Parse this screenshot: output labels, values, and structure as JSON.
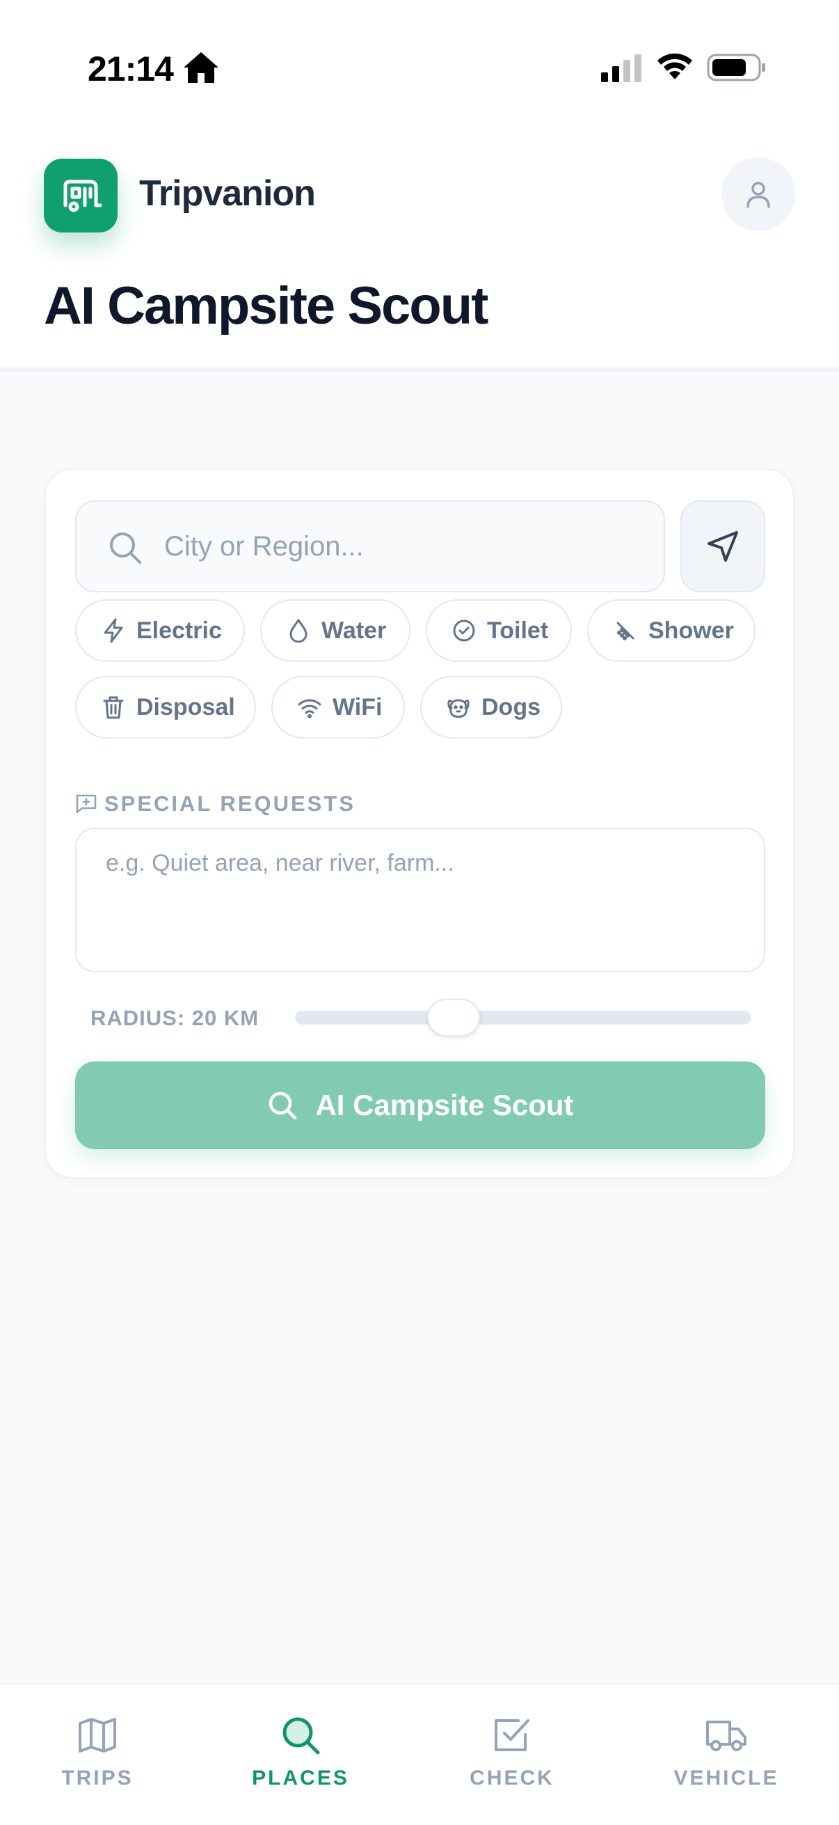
{
  "status_bar": {
    "time": "21:14",
    "icons": [
      "home-icon",
      "cellular-signal-icon",
      "wifi-icon",
      "battery-icon"
    ]
  },
  "header": {
    "app_name": "Tripvanion",
    "logo_icon": "caravan-icon",
    "profile_icon": "user-icon",
    "title": "AI Campsite Scout"
  },
  "search": {
    "placeholder": "City or Region...",
    "value": "",
    "icon": "search-icon",
    "locate_icon": "navigation-arrow-icon"
  },
  "amenities": [
    {
      "label": "Electric",
      "icon": "lightning-icon",
      "selected": false
    },
    {
      "label": "Water",
      "icon": "droplet-icon",
      "selected": false
    },
    {
      "label": "Toilet",
      "icon": "check-circle-icon",
      "selected": false
    },
    {
      "label": "Shower",
      "icon": "shower-icon",
      "selected": false
    },
    {
      "label": "Disposal",
      "icon": "trash-icon",
      "selected": false
    },
    {
      "label": "WiFi",
      "icon": "wifi-icon",
      "selected": false
    },
    {
      "label": "Dogs",
      "icon": "dog-icon",
      "selected": false
    }
  ],
  "special_requests": {
    "label": "SPECIAL REQUESTS",
    "icon": "message-plus-icon",
    "placeholder": "e.g. Quiet area, near river, farm...",
    "value": ""
  },
  "radius": {
    "label": "RADIUS: 20 KM",
    "value_km": 20,
    "level": 0.29
  },
  "scout_button": {
    "label": "AI Campsite Scout",
    "icon": "search-icon",
    "enabled": false
  },
  "bottom_nav": [
    {
      "label": "TRIPS",
      "icon": "map-icon",
      "active": false
    },
    {
      "label": "PLACES",
      "icon": "search-icon",
      "active": true
    },
    {
      "label": "CHECK",
      "icon": "checkbox-icon",
      "active": false
    },
    {
      "label": "VEHICLE",
      "icon": "truck-icon",
      "active": false
    }
  ],
  "colors": {
    "brand": "#10a06f",
    "brand_disabled": "#81cbb1",
    "nav_active": "#0e9668",
    "muted": "#94a3b8",
    "chip_text": "#64748b",
    "title": "#0f172a"
  }
}
